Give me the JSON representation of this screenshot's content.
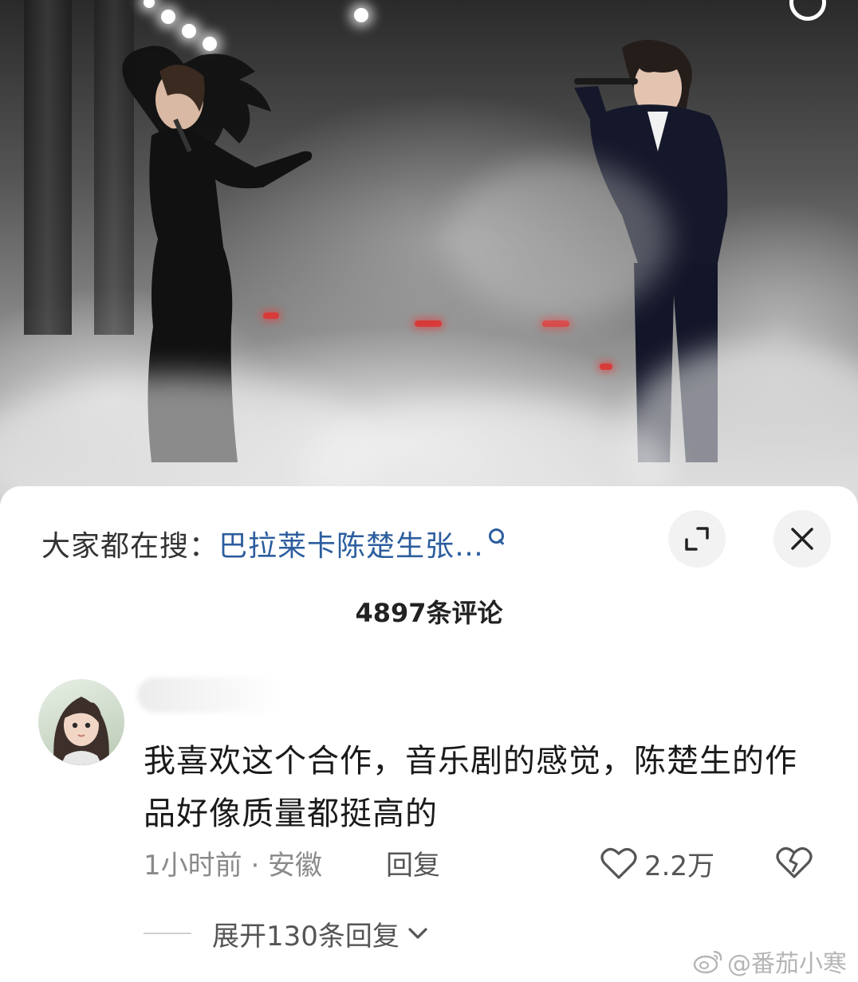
{
  "hot_search": {
    "prefix": "大家都在搜：",
    "query": "巴拉莱卡陈楚生张…"
  },
  "comment_count": "4897条评论",
  "comment": {
    "text": "我喜欢这个合作，音乐剧的感觉，陈楚生的作品好像质量都挺高的",
    "time_location": "1小时前 · 安徽",
    "reply_label": "回复",
    "like_count": "2.2万",
    "expand_label": "展开130条回复"
  },
  "watermark": "@番茄小寒",
  "icons": {
    "search": "search-icon",
    "minimize": "minimize-icon",
    "close": "close-icon",
    "like": "heart-icon",
    "dislike": "broken-heart-icon",
    "expand": "chevron-down-icon"
  },
  "colors": {
    "link_blue": "#2c5d9e",
    "muted_text": "#8a8a8a",
    "button_bg": "#f2f2f2"
  }
}
